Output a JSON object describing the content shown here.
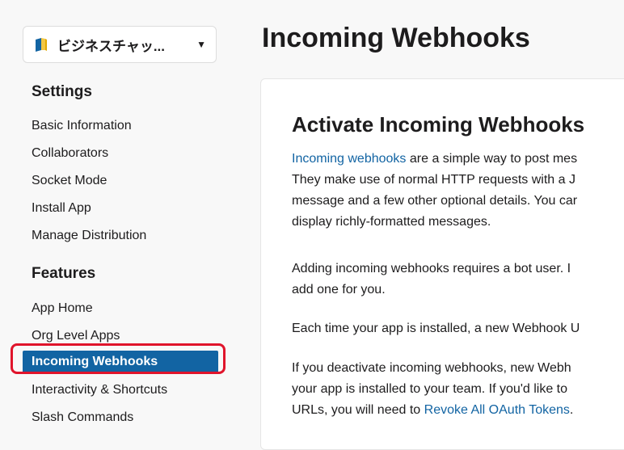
{
  "app_switcher": {
    "name": "ビジネスチャッ...",
    "icon": "book-icon",
    "caret": "▼"
  },
  "sidebar": {
    "settings_title": "Settings",
    "settings_items": [
      {
        "label": "Basic Information"
      },
      {
        "label": "Collaborators"
      },
      {
        "label": "Socket Mode"
      },
      {
        "label": "Install App"
      },
      {
        "label": "Manage Distribution"
      }
    ],
    "features_title": "Features",
    "features_items": [
      {
        "label": "App Home"
      },
      {
        "label": "Org Level Apps"
      },
      {
        "label": "Incoming Webhooks",
        "active": true
      },
      {
        "label": "Interactivity & Shortcuts"
      },
      {
        "label": "Slash Commands"
      }
    ]
  },
  "main": {
    "page_title": "Incoming Webhooks",
    "card_title": "Activate Incoming Webhooks",
    "p1": {
      "link": "Incoming webhooks",
      "line1_rest": " are a simple way to post mes",
      "line2": "They make use of normal HTTP requests with a J",
      "line3": "message and a few other optional details. You car",
      "line4": "display richly-formatted messages."
    },
    "p2": {
      "line1": "Adding incoming webhooks requires a bot user. I",
      "line2": "add one for you."
    },
    "p3": {
      "line1": "Each time your app is installed, a new Webhook U"
    },
    "p4": {
      "line1": "If you deactivate incoming webhooks, new Webh",
      "line2": "your app is installed to your team. If you'd like to",
      "line3_pre": "URLs, you will need to ",
      "line3_link": "Revoke All OAuth Tokens",
      "line3_post": "."
    }
  },
  "colors": {
    "accent": "#1264a3",
    "highlight": "#e0142b",
    "text": "#1d1c1d",
    "background": "#f8f8f8"
  }
}
